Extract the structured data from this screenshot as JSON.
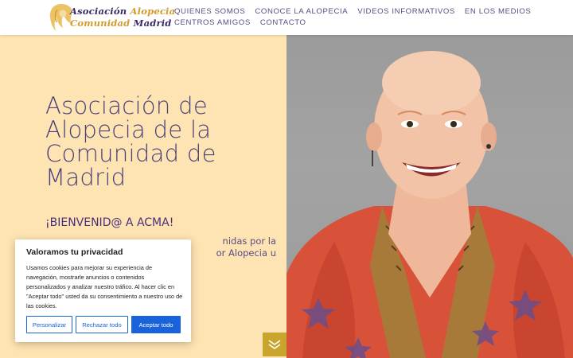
{
  "logo": {
    "line1_a": "Asociación",
    "line1_b": "Alopecia",
    "line2_a": "Comunidad",
    "line2_b": "Madrid",
    "icon": "hair-silhouette-logo"
  },
  "nav": {
    "row1": [
      "QUIENES SOMOS",
      "CONOCE LA ALOPECIA",
      "VIDEOS INFORMATIVOS",
      "EN LOS MEDIOS"
    ],
    "row2": [
      "CENTROS AMIGOS",
      "CONTACTO"
    ]
  },
  "hero": {
    "title_lines": [
      "Asociación de",
      "Alopecia de la",
      "Comunidad de",
      "Madrid"
    ],
    "welcome": "¡BIENVENID@ A ACMA!",
    "intro_line1": "nidas por la",
    "intro_line2": "or Alopecia u"
  },
  "cookie": {
    "title": "Valoramos tu privacidad",
    "text": "Usamos cookies para mejorar su experiencia de navegación, mostrarle anuncios o contenidos personalizados y analizar nuestro tráfico. Al hacer clic en \"Aceptar todo\" usted da su consentimiento a nuestro uso de las cookies.",
    "btn_customize": "Personalizar",
    "btn_reject": "Rechazar todo",
    "btn_accept": "Aceptar todo"
  },
  "icons": {
    "scroll_down": "chevron-double-down-icon"
  },
  "colors": {
    "hero_bg": "#fde4b2",
    "brand_purple": "#4a3f78",
    "gold": "#c9a52e",
    "cookie_blue": "#1863dc"
  }
}
